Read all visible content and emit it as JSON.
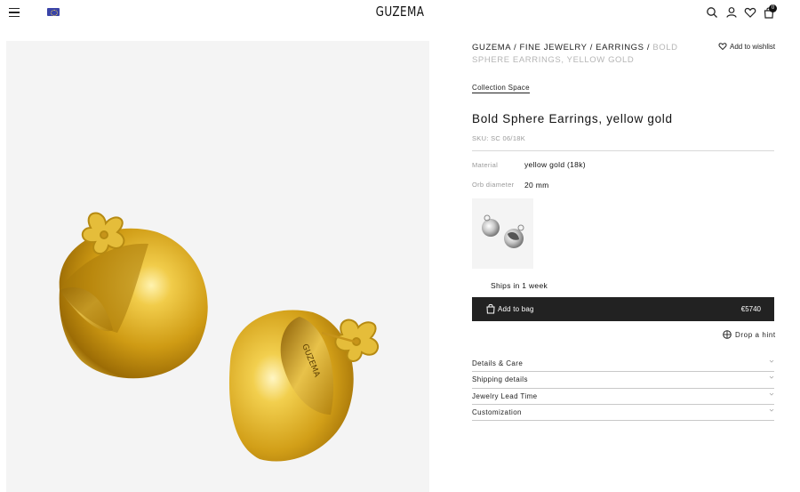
{
  "header": {
    "logo": "GUZEMA",
    "cart_count": "0"
  },
  "breadcrumb": {
    "items": [
      "GUZEMA",
      "FINE JEWELRY",
      "EARRINGS"
    ],
    "separator": " / ",
    "current": "BOLD SPHERE EARRINGS, YELLOW GOLD"
  },
  "wishlist_label": "Add to wishlist",
  "collection_link": "Collection Space",
  "product": {
    "title": "Bold Sphere Earrings, yellow gold",
    "sku": "SKU: SC 06/18K",
    "engraving": "GUZEMA",
    "specs": [
      {
        "label": "Material",
        "value": "yellow gold (18k)"
      },
      {
        "label": "Orb diameter",
        "value": "20 mm"
      }
    ],
    "ships": "Ships in 1 week",
    "add_to_bag": "Add to bag",
    "price": "€5740"
  },
  "hint_label": "Drop a hint",
  "accordion": [
    "Details & Care",
    "Shipping details",
    "Jewelry Lead Time",
    "Customization"
  ],
  "colors": {
    "accent": "#222222",
    "gold": "#d9a820",
    "muted": "#9a9a9a",
    "panel_bg": "#f4f4f4"
  },
  "icons": [
    "menu-icon",
    "eu-flag-icon",
    "search-icon",
    "user-icon",
    "heart-icon",
    "cart-icon",
    "bag-icon",
    "gift-icon",
    "chevron-down-icon"
  ]
}
